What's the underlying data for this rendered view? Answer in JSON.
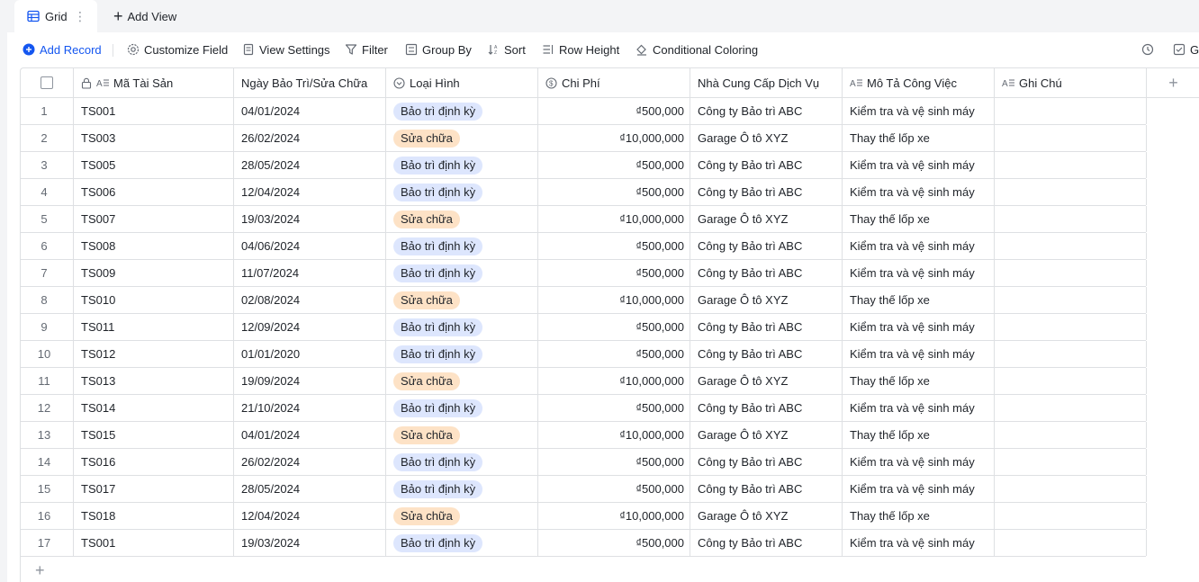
{
  "views": {
    "active_tab": "Grid",
    "more_icon": "more-vertical-icon",
    "add_view_label": "Add View"
  },
  "toolbar": {
    "add_record": "Add Record",
    "customize_field": "Customize Field",
    "view_settings": "View Settings",
    "filter": "Filter",
    "group_by": "Group By",
    "sort": "Sort",
    "row_height": "Row Height",
    "conditional_coloring": "Conditional Coloring",
    "right_truncated": "Ge",
    "accent_color": "#1456f0"
  },
  "columns": [
    {
      "label": "Mã Tài Sản",
      "icon": "text-field-icon"
    },
    {
      "label": "Ngày Bảo Trì/Sửa Chữa",
      "icon": ""
    },
    {
      "label": "Loại Hình",
      "icon": "single-select-icon"
    },
    {
      "label": "Chi Phí",
      "icon": "currency-icon"
    },
    {
      "label": "Nhà Cung Cấp Dịch Vụ",
      "icon": ""
    },
    {
      "label": "Mô Tả Công Việc",
      "icon": "text-field-icon"
    },
    {
      "label": "Ghi Chú",
      "icon": "text-field-icon"
    }
  ],
  "tag_colors": {
    "Bảo trì định kỳ": {
      "bg": "#dde6fd",
      "fg": "#1f2329"
    },
    "Sửa chữa": {
      "bg": "#fde2c6",
      "fg": "#1f2329"
    }
  },
  "rows": [
    {
      "n": "1",
      "id": "TS001",
      "date": "04/01/2024",
      "type": "Bảo trì định kỳ",
      "cost": "₫500,000",
      "vendor": "Công ty Bảo trì ABC",
      "desc": "Kiểm tra và vệ sinh máy",
      "note": ""
    },
    {
      "n": "2",
      "id": "TS003",
      "date": "26/02/2024",
      "type": "Sửa chữa",
      "cost": "₫10,000,000",
      "vendor": "Garage Ô tô XYZ",
      "desc": "Thay thế lốp xe",
      "note": ""
    },
    {
      "n": "3",
      "id": "TS005",
      "date": "28/05/2024",
      "type": "Bảo trì định kỳ",
      "cost": "₫500,000",
      "vendor": "Công ty Bảo trì ABC",
      "desc": "Kiểm tra và vệ sinh máy",
      "note": ""
    },
    {
      "n": "4",
      "id": "TS006",
      "date": "12/04/2024",
      "type": "Bảo trì định kỳ",
      "cost": "₫500,000",
      "vendor": "Công ty Bảo trì ABC",
      "desc": "Kiểm tra và vệ sinh máy",
      "note": ""
    },
    {
      "n": "5",
      "id": "TS007",
      "date": "19/03/2024",
      "type": "Sửa chữa",
      "cost": "₫10,000,000",
      "vendor": "Garage Ô tô XYZ",
      "desc": "Thay thế lốp xe",
      "note": ""
    },
    {
      "n": "6",
      "id": "TS008",
      "date": "04/06/2024",
      "type": "Bảo trì định kỳ",
      "cost": "₫500,000",
      "vendor": "Công ty Bảo trì ABC",
      "desc": "Kiểm tra và vệ sinh máy",
      "note": ""
    },
    {
      "n": "7",
      "id": "TS009",
      "date": "11/07/2024",
      "type": "Bảo trì định kỳ",
      "cost": "₫500,000",
      "vendor": "Công ty Bảo trì ABC",
      "desc": "Kiểm tra và vệ sinh máy",
      "note": ""
    },
    {
      "n": "8",
      "id": "TS010",
      "date": "02/08/2024",
      "type": "Sửa chữa",
      "cost": "₫10,000,000",
      "vendor": "Garage Ô tô XYZ",
      "desc": "Thay thế lốp xe",
      "note": ""
    },
    {
      "n": "9",
      "id": "TS011",
      "date": "12/09/2024",
      "type": "Bảo trì định kỳ",
      "cost": "₫500,000",
      "vendor": "Công ty Bảo trì ABC",
      "desc": "Kiểm tra và vệ sinh máy",
      "note": ""
    },
    {
      "n": "10",
      "id": "TS012",
      "date": "01/01/2020",
      "type": "Bảo trì định kỳ",
      "cost": "₫500,000",
      "vendor": "Công ty Bảo trì ABC",
      "desc": "Kiểm tra và vệ sinh máy",
      "note": ""
    },
    {
      "n": "11",
      "id": "TS013",
      "date": "19/09/2024",
      "type": "Sửa chữa",
      "cost": "₫10,000,000",
      "vendor": "Garage Ô tô XYZ",
      "desc": "Thay thế lốp xe",
      "note": ""
    },
    {
      "n": "12",
      "id": "TS014",
      "date": "21/10/2024",
      "type": "Bảo trì định kỳ",
      "cost": "₫500,000",
      "vendor": "Công ty Bảo trì ABC",
      "desc": "Kiểm tra và vệ sinh máy",
      "note": ""
    },
    {
      "n": "13",
      "id": "TS015",
      "date": "04/01/2024",
      "type": "Sửa chữa",
      "cost": "₫10,000,000",
      "vendor": "Garage Ô tô XYZ",
      "desc": "Thay thế lốp xe",
      "note": ""
    },
    {
      "n": "14",
      "id": "TS016",
      "date": "26/02/2024",
      "type": "Bảo trì định kỳ",
      "cost": "₫500,000",
      "vendor": "Công ty Bảo trì ABC",
      "desc": "Kiểm tra và vệ sinh máy",
      "note": ""
    },
    {
      "n": "15",
      "id": "TS017",
      "date": "28/05/2024",
      "type": "Bảo trì định kỳ",
      "cost": "₫500,000",
      "vendor": "Công ty Bảo trì ABC",
      "desc": "Kiểm tra và vệ sinh máy",
      "note": ""
    },
    {
      "n": "16",
      "id": "TS018",
      "date": "12/04/2024",
      "type": "Sửa chữa",
      "cost": "₫10,000,000",
      "vendor": "Garage Ô tô XYZ",
      "desc": "Thay thế lốp xe",
      "note": ""
    },
    {
      "n": "17",
      "id": "TS001",
      "date": "19/03/2024",
      "type": "Bảo trì định kỳ",
      "cost": "₫500,000",
      "vendor": "Công ty Bảo trì ABC",
      "desc": "Kiểm tra và vệ sinh máy",
      "note": ""
    }
  ]
}
